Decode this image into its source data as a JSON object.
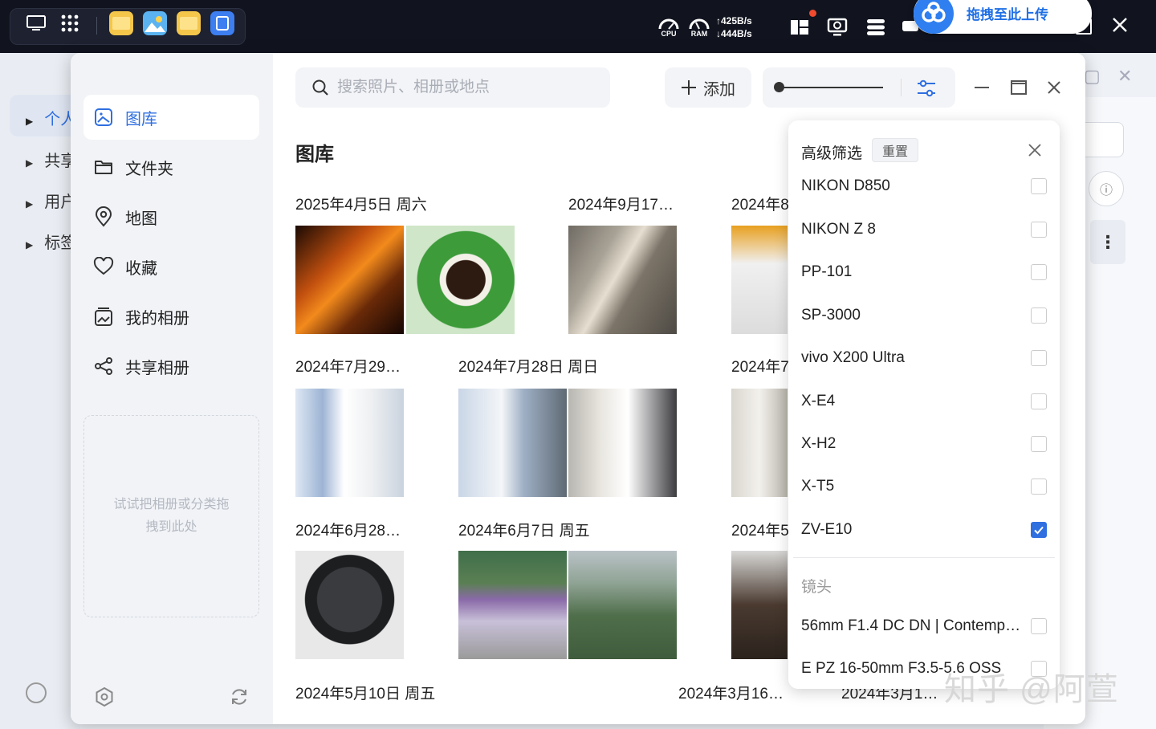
{
  "taskbar": {
    "cpu_label": "CPU",
    "ram_label": "RAM",
    "net_up": "425B/s",
    "net_down": "444B/s",
    "upload_text": "拖拽至此上传"
  },
  "background": {
    "sidebar_items": [
      "个人",
      "共享",
      "用户",
      "标签"
    ]
  },
  "sidebar": {
    "items": [
      {
        "label": "图库",
        "icon": "gallery-icon"
      },
      {
        "label": "文件夹",
        "icon": "folder-icon"
      },
      {
        "label": "地图",
        "icon": "map-pin-icon"
      },
      {
        "label": "收藏",
        "icon": "heart-icon"
      },
      {
        "label": "我的相册",
        "icon": "album-icon"
      },
      {
        "label": "共享相册",
        "icon": "share-icon"
      }
    ],
    "dropzone_text": "试试把相册或分类拖拽到此处"
  },
  "header": {
    "search_placeholder": "搜索照片、相册或地点",
    "add_label": "添加"
  },
  "gallery": {
    "title": "图库",
    "dates": [
      "2025年4月5日 周六",
      "2024年9月17…",
      "2024年8",
      "2024年7月29…",
      "2024年7月28日 周日",
      "2024年7",
      "2024年6月28…",
      "2024年6月7日 周五",
      "2024年5",
      "2024年5月10日 周五",
      "2024年3月16…",
      "2024年3月1…"
    ]
  },
  "filter": {
    "title": "高级筛选",
    "reset_label": "重置",
    "cameras": [
      {
        "label": "NIKON D850",
        "checked": false
      },
      {
        "label": "NIKON Z 8",
        "checked": false
      },
      {
        "label": "PP-101",
        "checked": false
      },
      {
        "label": "SP-3000",
        "checked": false
      },
      {
        "label": "vivo X200 Ultra",
        "checked": false
      },
      {
        "label": "X-E4",
        "checked": false
      },
      {
        "label": "X-H2",
        "checked": false
      },
      {
        "label": "X-T5",
        "checked": false
      },
      {
        "label": "ZV-E10",
        "checked": true
      }
    ],
    "lens_section": "镜头",
    "lenses": [
      {
        "label": "56mm F1.4 DC DN | Contemp…",
        "checked": false
      },
      {
        "label": "E PZ 16-50mm F3.5-5.6 OSS",
        "checked": false
      }
    ]
  },
  "watermark": "知乎 @阿萱",
  "colors": {
    "accent": "#2f6fe0",
    "taskbar": "#11141f"
  }
}
